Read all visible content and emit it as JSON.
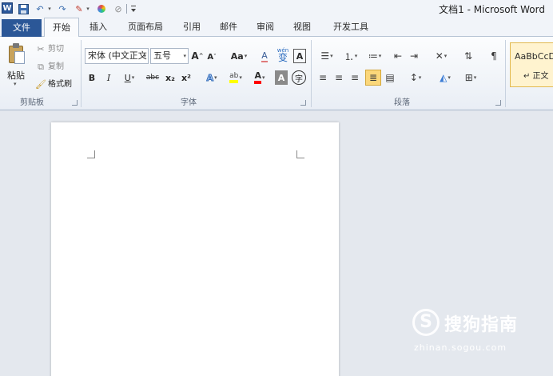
{
  "title_bar": {
    "title": "文档1 - Microsoft Word",
    "qat_icons": [
      "word-logo-icon",
      "save-icon",
      "undo-icon",
      "redo-icon",
      "format-brush-icon",
      "color-wheel-icon",
      "strike-icon",
      "customize-qat-icon"
    ]
  },
  "tabs": {
    "file": "文件",
    "home": "开始",
    "insert": "插入",
    "layout": "页面布局",
    "references": "引用",
    "mailings": "邮件",
    "review": "审阅",
    "view": "视图",
    "developer": "开发工具",
    "active": "home"
  },
  "clipboard": {
    "paste": "粘贴",
    "cut": "剪切",
    "copy": "复制",
    "format_painter": "格式刷",
    "label": "剪贴板"
  },
  "font": {
    "name": "宋体 (中文正文",
    "size": "五号",
    "bold": "B",
    "italic": "I",
    "underline": "U",
    "strikethrough": "abc",
    "subscript": "x₂",
    "superscript": "x²",
    "grow": "A",
    "shrink": "A",
    "change_case": "Aa",
    "clear_format": "A",
    "highlight": "ab",
    "font_color": "A",
    "char_shading": "A",
    "enclose": "字",
    "pinyin": "变",
    "border": "A",
    "label": "字体"
  },
  "paragraph": {
    "label": "段落",
    "active_alignment": "justify"
  },
  "styles": {
    "sample": "AaBbCcDc",
    "name": "↵ 正文"
  },
  "watermark": {
    "name": "搜狗指南",
    "url": "zhinan.sogou.com",
    "glyph": "S"
  },
  "colors": {
    "file_tab": "#2b5797",
    "highlight_yellow": "#ffff00",
    "font_color_red": "#ff0000",
    "active_align": "#fbd77a"
  }
}
